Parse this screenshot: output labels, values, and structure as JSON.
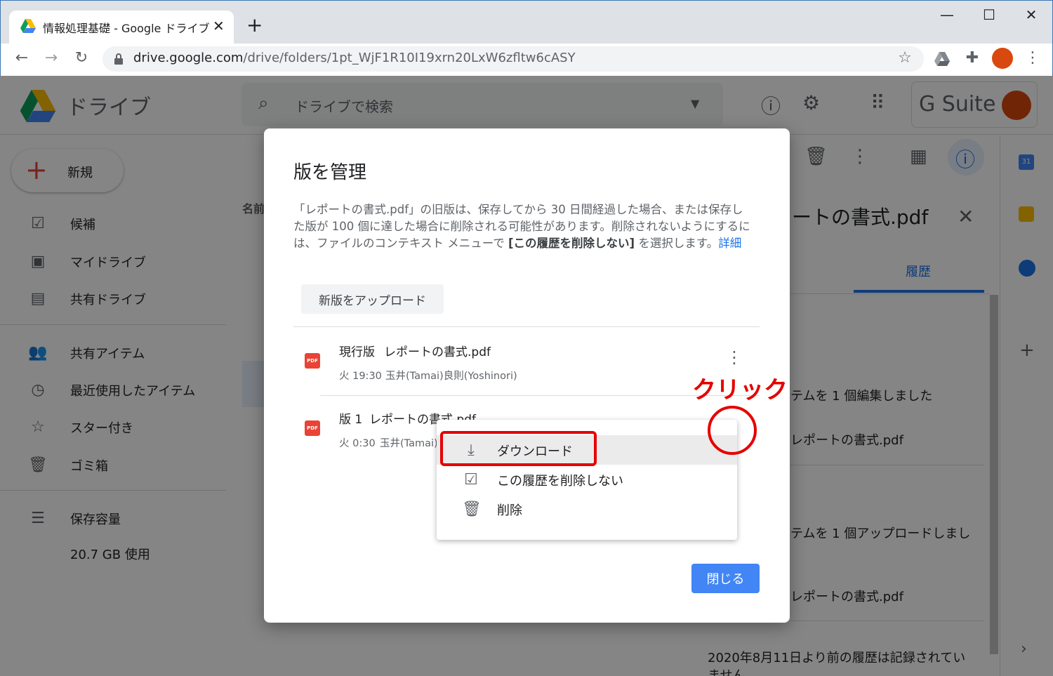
{
  "browser": {
    "tab_title": "情報処理基礎 - Google ドライブ",
    "url_host": "drive.google.com",
    "url_path": "/drive/folders/1pt_WjF1R10I19xrn20LxW6zfltw6cASY"
  },
  "drive": {
    "brand": "ドライブ",
    "search_placeholder": "ドライブで検索",
    "gsuite_label": "G Suite",
    "new_button": "新規",
    "col_header": "名前",
    "sidebar": [
      {
        "label": "候補",
        "icon": "check-square-icon"
      },
      {
        "label": "マイドライブ",
        "icon": "my-drive-icon"
      },
      {
        "label": "共有ドライブ",
        "icon": "shared-drive-icon"
      },
      {
        "label": "共有アイテム",
        "icon": "people-icon"
      },
      {
        "label": "最近使用したアイテム",
        "icon": "clock-icon"
      },
      {
        "label": "スター付き",
        "icon": "star-icon"
      },
      {
        "label": "ゴミ箱",
        "icon": "trash-icon"
      },
      {
        "label": "保存容量",
        "icon": "storage-icon"
      }
    ],
    "storage_used": "20.7 GB 使用"
  },
  "right_panel": {
    "file_title": "ートの書式.pdf",
    "tab_history": "履歴",
    "activity1": "テムを 1 個編集しました",
    "activity1_file": "レポートの書式.pdf",
    "activity2": "テムを 1 個アップロードしまし",
    "activity2_file": "レポートの書式.pdf",
    "note": "2020年8月11日より前の履歴は記録されてい",
    "note2": "ません。"
  },
  "dialog": {
    "title": "版を管理",
    "desc_1": "「レポートの書式.pdf」の旧版は、保存してから 30 日間経過した場合、または保存した版が 100 個に達した場合に削除される可能性があります。削除されないようにするには、ファイルのコンテキスト メニューで ",
    "desc_bold": "[この履歴を削除しない]",
    "desc_2": " を選択します。",
    "desc_link": "詳細",
    "upload_button": "新版をアップロード",
    "versions": [
      {
        "label": "現行版",
        "filename": "レポートの書式.pdf",
        "time": "火 19:30",
        "author": "玉井(Tamai)良則(Yoshinori)"
      },
      {
        "label": "版 1",
        "filename": "レポートの書式.pdf",
        "time": "火 0:30",
        "author": "玉井(Tamai)"
      }
    ],
    "close_button": "閉じる"
  },
  "menu": {
    "download": "ダウンロード",
    "keep_forever": "この履歴を削除しない",
    "delete": "削除"
  },
  "annotation": {
    "click_label": "クリック"
  },
  "colors": {
    "accent_blue": "#4285f4",
    "link_blue": "#1a73e8",
    "highlight_red": "#e60000",
    "pdf_red": "#ea4335"
  }
}
